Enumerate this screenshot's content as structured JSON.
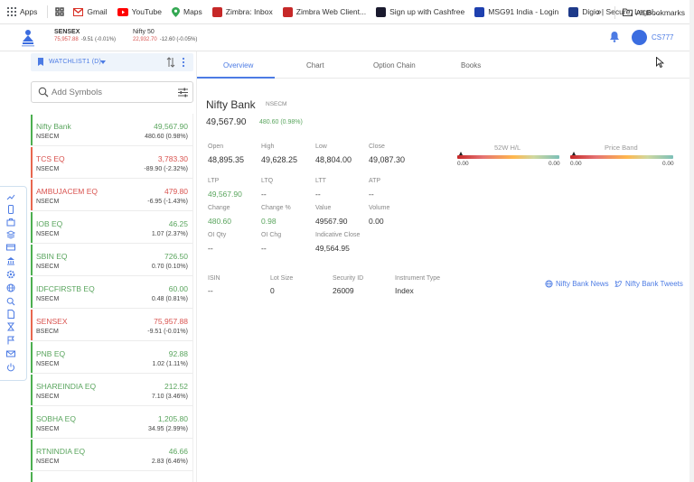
{
  "bookmarks": [
    {
      "label": "Apps",
      "color": "#5f6368"
    },
    {
      "label": "Gmail",
      "color": "#d93025"
    },
    {
      "label": "YouTube",
      "color": "#ff0000"
    },
    {
      "label": "Maps",
      "color": "#34a853"
    },
    {
      "label": "Zimbra: Inbox",
      "color": "#c62828"
    },
    {
      "label": "Zimbra Web Client...",
      "color": "#c62828"
    },
    {
      "label": "Sign up with Cashfree",
      "color": "#1a1a2e"
    },
    {
      "label": "MSG91 India - Login",
      "color": "#1e40af"
    },
    {
      "label": "Digio | Secure, Legal...",
      "color": "#1e3a8a"
    }
  ],
  "bookmarks_more": "»",
  "all_bookmarks": "All Bookmarks",
  "header": {
    "indices": [
      {
        "name": "SENSEX",
        "value": "75,957.88",
        "change": "-9.51 (-0.01%)"
      },
      {
        "name": "Nifty 50",
        "value": "22,932.70",
        "change": "-12.60 (-0.05%)"
      }
    ],
    "user": "CS777"
  },
  "watchlist": {
    "title": "WATCHLIST1 (D)",
    "search_placeholder": "Add Symbols",
    "items": [
      {
        "symbol": "Nifty Bank",
        "exchange": "NSECM",
        "ltp": "49,567.90",
        "change": "480.60  (0.98%)",
        "dir": "up"
      },
      {
        "symbol": "TCS EQ",
        "exchange": "NSECM",
        "ltp": "3,783.30",
        "change": "-89.90  (-2.32%)",
        "dir": "dn"
      },
      {
        "symbol": "AMBUJACEM EQ",
        "exchange": "NSECM",
        "ltp": "479.80",
        "change": "-6.95  (-1.43%)",
        "dir": "dn"
      },
      {
        "symbol": "IOB EQ",
        "exchange": "NSECM",
        "ltp": "46.25",
        "change": "1.07  (2.37%)",
        "dir": "up"
      },
      {
        "symbol": "SBIN EQ",
        "exchange": "NSECM",
        "ltp": "726.50",
        "change": "0.70  (0.10%)",
        "dir": "up"
      },
      {
        "symbol": "IDFCFIRSTB EQ",
        "exchange": "NSECM",
        "ltp": "60.00",
        "change": "0.48  (0.81%)",
        "dir": "up"
      },
      {
        "symbol": "SENSEX",
        "exchange": "BSECM",
        "ltp": "75,957.88",
        "change": "-9.51  (-0.01%)",
        "dir": "dn"
      },
      {
        "symbol": "PNB EQ",
        "exchange": "NSECM",
        "ltp": "92.88",
        "change": "1.02  (1.11%)",
        "dir": "up"
      },
      {
        "symbol": "SHAREINDIA EQ",
        "exchange": "NSECM",
        "ltp": "212.52",
        "change": "7.10  (3.46%)",
        "dir": "up"
      },
      {
        "symbol": "SOBHA EQ",
        "exchange": "NSECM",
        "ltp": "1,205.80",
        "change": "34.95  (2.99%)",
        "dir": "up"
      },
      {
        "symbol": "RTNINDIA EQ",
        "exchange": "NSECM",
        "ltp": "46.66",
        "change": "2.83  (6.46%)",
        "dir": "up"
      }
    ]
  },
  "tabs": [
    "Overview",
    "Chart",
    "Option Chain",
    "Books"
  ],
  "detail": {
    "symbol": "Nifty Bank",
    "exchange": "NSECM",
    "ltp": "49,567.90",
    "change": "480.60 (0.98%)",
    "open_label": "Open",
    "open": "48,895.35",
    "high_label": "High",
    "high": "49,628.25",
    "low_label": "Low",
    "low": "48,804.00",
    "close_label": "Close",
    "close": "49,087.30",
    "ltp_label": "LTP",
    "ltp_val": "49,567.90",
    "ltq_label": "LTQ",
    "ltq": "--",
    "ltt_label": "LTT",
    "ltt": "--",
    "atp_label": "ATP",
    "atp": "--",
    "chg_label": "Change",
    "chg": "480.60",
    "chgpct_label": "Change %",
    "chgpct": "0.98",
    "value_label": "Value",
    "value": "49567.90",
    "volume_label": "Volume",
    "volume": "0.00",
    "oiqty_label": "OI Qty",
    "oiqty": "--",
    "oichg_label": "OI Chg",
    "oichg": "--",
    "indclose_label": "Indicative Close",
    "indclose": "49,564.95",
    "isin_label": "ISIN",
    "isin": "--",
    "lot_label": "Lot Size",
    "lot": "0",
    "secid_label": "Security ID",
    "secid": "26009",
    "insttype_label": "Instrument Type",
    "insttype": "Index",
    "band52_label": "52W H/L",
    "band52_low": "0.00",
    "band52_high": "0.00",
    "price_band_label": "Price Band",
    "pb_low": "0.00",
    "pb_high": "0.00",
    "news_label": "Nifty Bank News",
    "tweets_label": "Nifty Bank Tweets"
  }
}
